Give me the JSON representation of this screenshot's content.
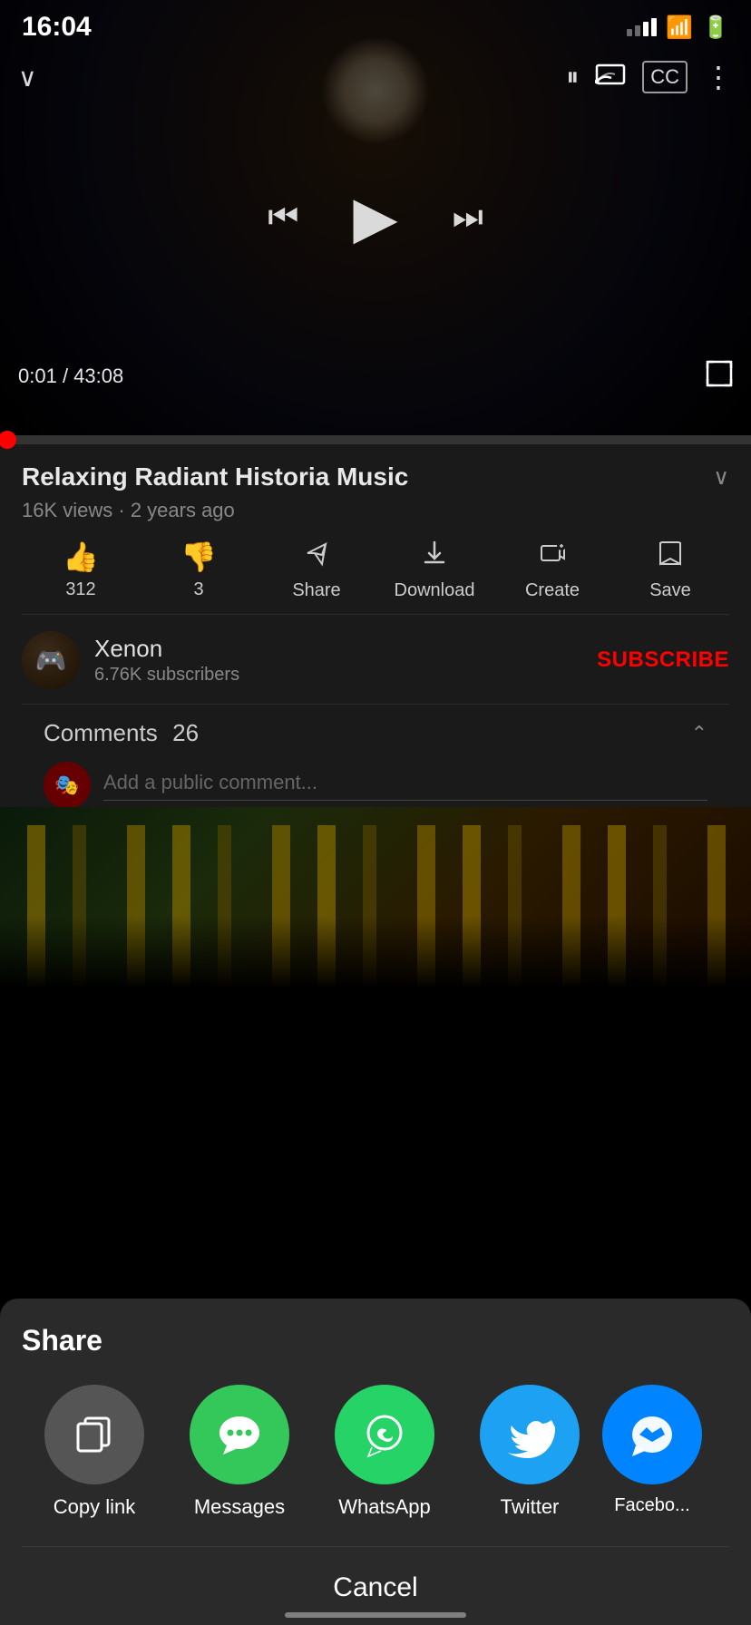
{
  "statusBar": {
    "time": "16:04",
    "locationIcon": "▲"
  },
  "videoPlayer": {
    "currentTime": "0:01",
    "totalTime": "43:08",
    "pauseIcon": "⏸",
    "prevIcon": "⏮",
    "playIcon": "▶",
    "nextIcon": "⏭",
    "castIcon": "📺",
    "ccIcon": "CC",
    "moreIcon": "⋮",
    "collapseIcon": "∨",
    "fullscreenIcon": "⛶",
    "progressPercent": 0.04
  },
  "videoInfo": {
    "title": "Relaxing Radiant Historia Music",
    "views": "16K views",
    "timeAgo": "2 years ago",
    "meta": "16K views · 2 years ago"
  },
  "actions": {
    "like": {
      "icon": "👍",
      "count": "312",
      "label": ""
    },
    "dislike": {
      "icon": "👎",
      "count": "3",
      "label": ""
    },
    "share": {
      "icon": "↗",
      "label": "Share"
    },
    "download": {
      "icon": "⬇",
      "label": "Download"
    },
    "create": {
      "icon": "🎬",
      "label": "Create"
    },
    "save": {
      "label": "Save"
    }
  },
  "channel": {
    "name": "Xenon",
    "subscribers": "6.76K subscribers",
    "subscribeLabel": "SUBSCRIBE"
  },
  "comments": {
    "label": "Comments",
    "count": "26",
    "placeholder": "Add a public comment..."
  },
  "shareSheet": {
    "title": "Share",
    "cancelLabel": "Cancel",
    "apps": [
      {
        "id": "copy-link",
        "label": "Copy link",
        "iconClass": "icon-copy",
        "iconText": "⧉"
      },
      {
        "id": "messages",
        "label": "Messages",
        "iconClass": "icon-messages",
        "iconText": "💬"
      },
      {
        "id": "whatsapp",
        "label": "WhatsApp",
        "iconClass": "icon-whatsapp",
        "iconText": "✆"
      },
      {
        "id": "twitter",
        "label": "Twitter",
        "iconClass": "icon-twitter",
        "iconText": "🐦"
      },
      {
        "id": "facebook-messenger",
        "label": "Facebook Messenger",
        "iconClass": "icon-messenger",
        "iconText": "🗨"
      }
    ]
  }
}
